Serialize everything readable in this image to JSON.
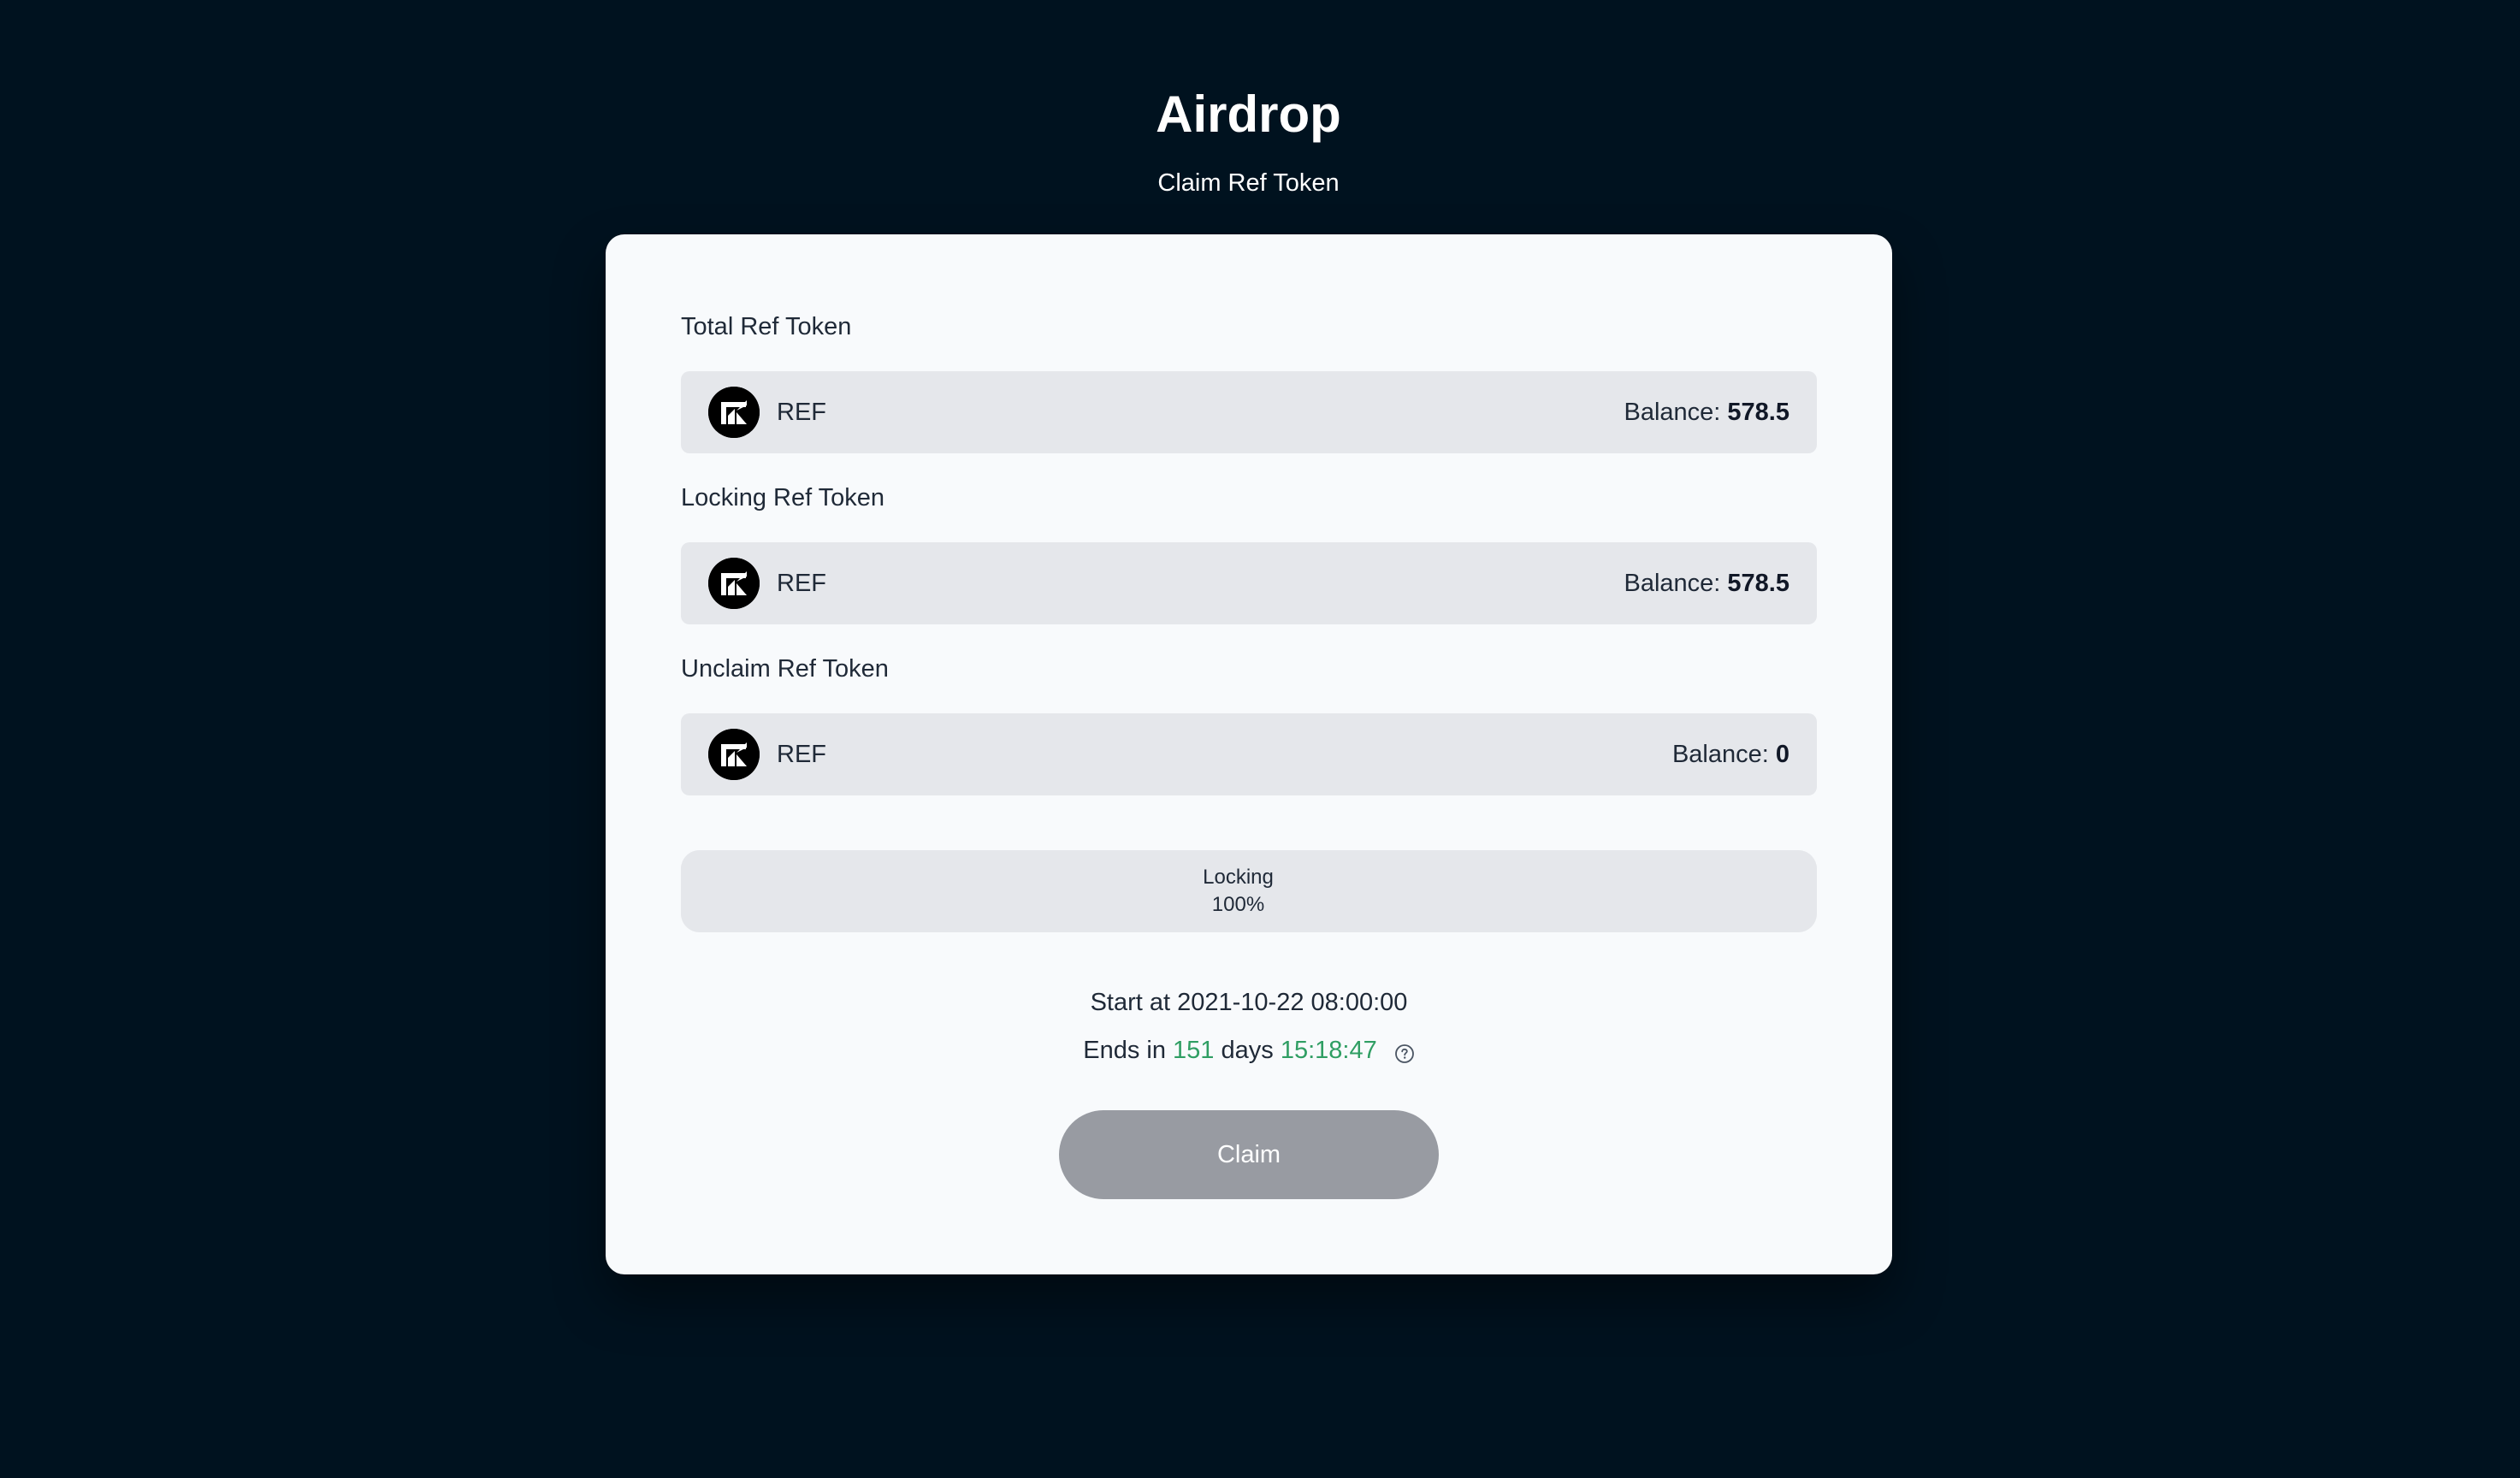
{
  "header": {
    "title": "Airdrop",
    "subtitle": "Claim Ref Token"
  },
  "sections": [
    {
      "label": "Total Ref Token",
      "token": "REF",
      "balance_label": "Balance: ",
      "balance_value": "578.5",
      "icon": "ref-token-icon"
    },
    {
      "label": "Locking Ref Token",
      "token": "REF",
      "balance_label": "Balance: ",
      "balance_value": "578.5",
      "icon": "ref-token-icon"
    },
    {
      "label": "Unclaim Ref Token",
      "token": "REF",
      "balance_label": "Balance: ",
      "balance_value": "0",
      "icon": "ref-token-icon"
    }
  ],
  "progress": {
    "label": "Locking",
    "percent_text": "100%",
    "fraction": 1.0
  },
  "schedule": {
    "start_prefix": "Start at",
    "start_time": "2021-10-22 08:00:00",
    "ends_prefix": "Ends in",
    "days": "151",
    "days_word": "days",
    "time_left": "15:18:47",
    "help_icon": "question-circle-icon"
  },
  "claim": {
    "label": "Claim",
    "disabled": true
  },
  "colors": {
    "background": "#00121f",
    "card": "#f8fafc",
    "row": "#e5e7eb",
    "accent_green": "#2f9e63",
    "button_disabled": "#989ba2"
  }
}
